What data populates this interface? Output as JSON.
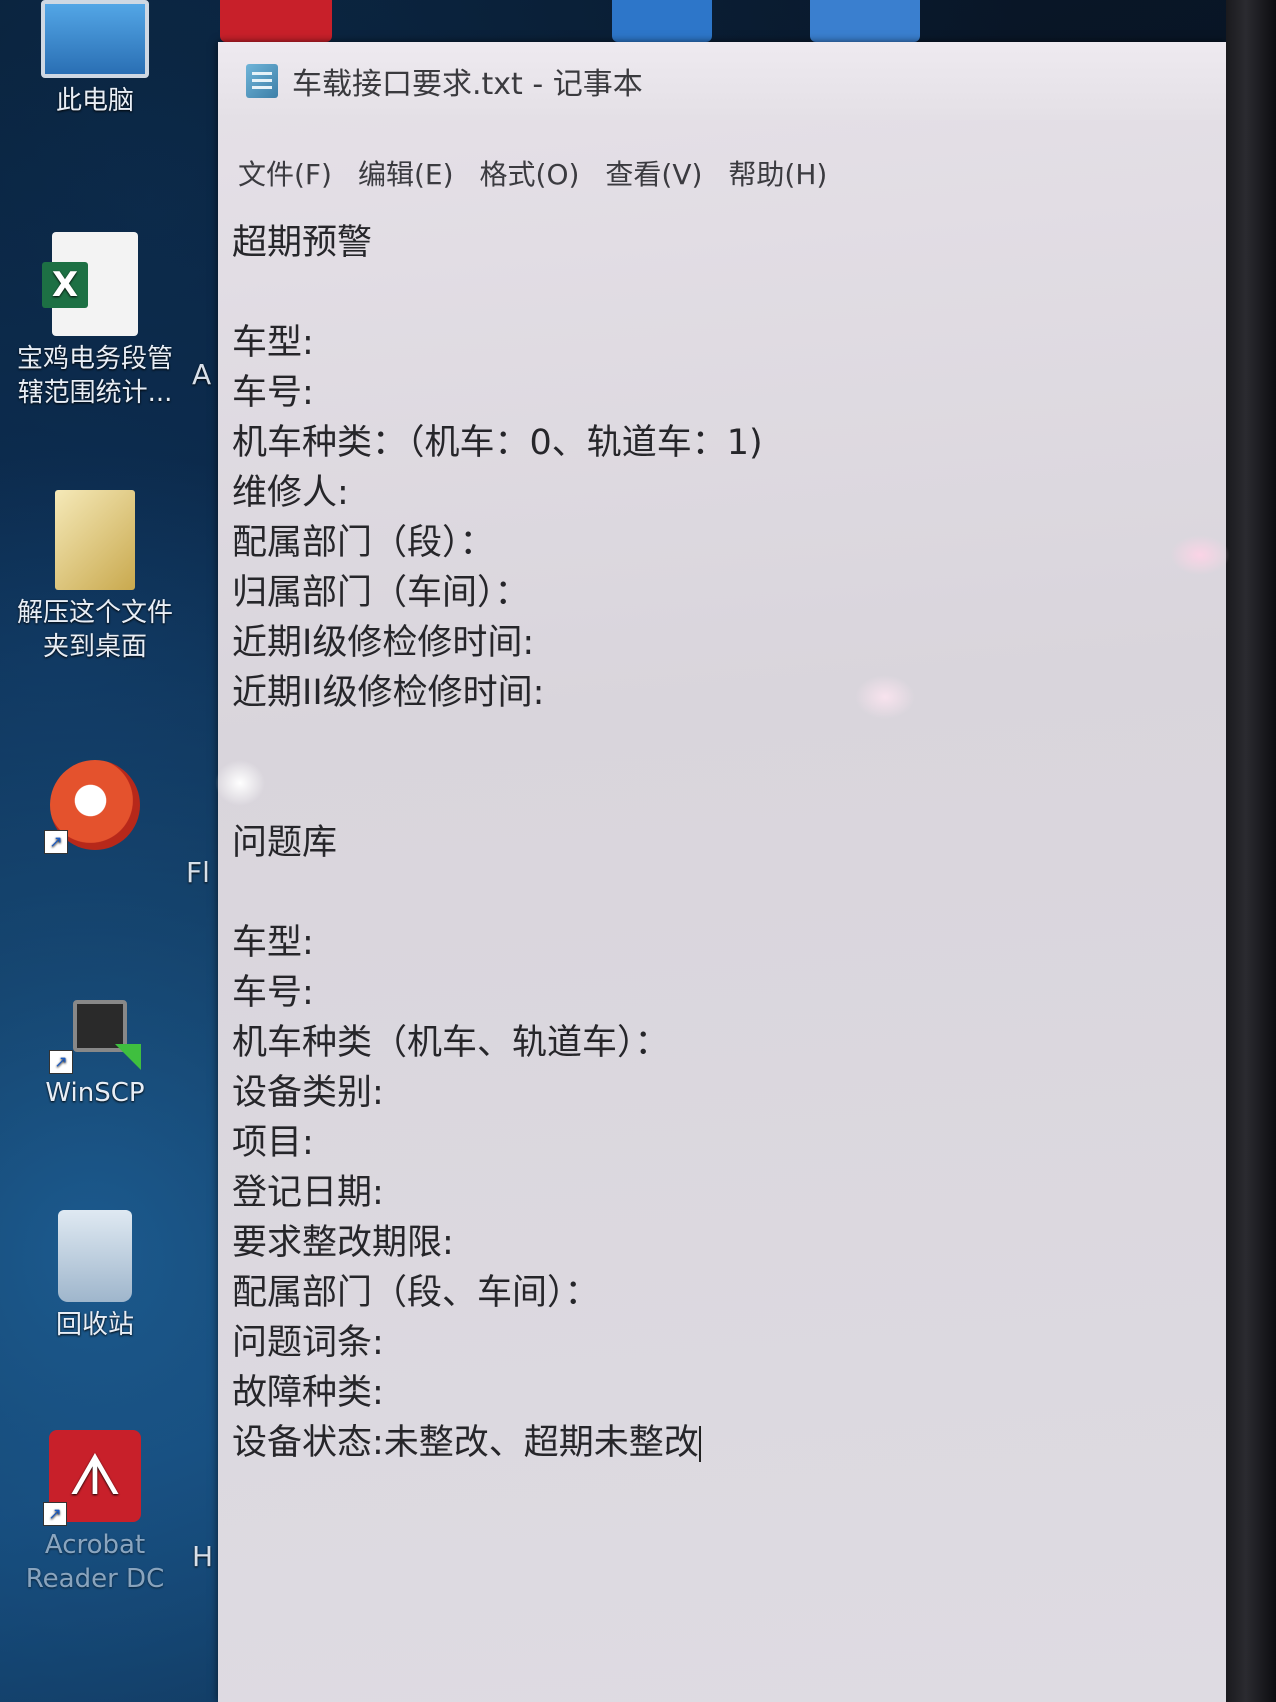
{
  "desktop": {
    "icons": [
      {
        "label": "此电脑",
        "glyph": "this-pc-icon"
      },
      {
        "label": "宝鸡电务段管\n辖范围统计...",
        "glyph": "excel-file-icon"
      },
      {
        "label": "解压这个文件\n夹到桌面",
        "glyph": "folder-icon"
      },
      {
        "label": "",
        "glyph": "video-player-icon"
      },
      {
        "label": "WinSCP",
        "glyph": "winscp-icon"
      },
      {
        "label": "回收站",
        "glyph": "recycle-bin-icon"
      },
      {
        "label": "Acrobat\nReader DC",
        "glyph": "acrobat-reader-icon"
      }
    ],
    "partial_labels": [
      "A",
      "Fl",
      "H"
    ]
  },
  "notepad": {
    "title": "车载接口要求.txt - 记事本",
    "menu": [
      "文件(F)",
      "编辑(E)",
      "格式(O)",
      "查看(V)",
      "帮助(H)"
    ],
    "lines": [
      "超期预警",
      "",
      "车型:",
      "车号:",
      "机车种类：（机车：0、轨道车：1)",
      "维修人:",
      "配属部门（段）：",
      "归属部门（车间）：",
      "近期I级修检修时间:",
      "近期II级修检修时间:",
      "",
      "",
      "问题库",
      "",
      "车型:",
      "车号:",
      "机车种类（机车、轨道车）：",
      "设备类别:",
      "项目:",
      "登记日期:",
      "要求整改期限:",
      "配属部门（段、车间）：",
      "问题词条:",
      "故障种类:",
      "设备状态:未整改、超期未整改"
    ]
  },
  "colors": {
    "notepad_bg": "#dedbe2",
    "text": "#26262a",
    "desktop_bg": "#0a1a2e"
  }
}
